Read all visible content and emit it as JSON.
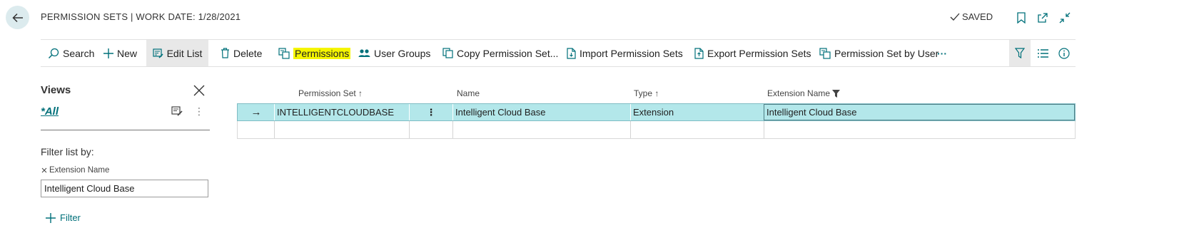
{
  "header": {
    "title": "PERMISSION SETS | WORK DATE: 1/28/2021",
    "saved_label": "SAVED"
  },
  "toolbar": {
    "search": "Search",
    "new": "New",
    "edit_list": "Edit List",
    "delete": "Delete",
    "permissions": "Permissions",
    "user_groups": "User Groups",
    "copy_permission_set": "Copy Permission Set...",
    "import_permission_sets": "Import Permission Sets",
    "export_permission_sets": "Export Permission Sets",
    "permission_set_by_user": "Permission Set by User",
    "more": "···"
  },
  "filter_pane": {
    "views_title": "Views",
    "view_all": "*All",
    "more": "⋮",
    "filter_list_by": "Filter list by:",
    "filter_field": "Extension Name",
    "filter_value": "Intelligent Cloud Base",
    "add_filter": "Filter"
  },
  "grid": {
    "columns": {
      "permission_set": "Permission Set ↑",
      "name": "Name",
      "type": "Type ↑",
      "extension_name": "Extension Name"
    },
    "rows": [
      {
        "indicator": "→",
        "permission_set": "INTELLIGENTCLOUDBASE",
        "actions": "⋮",
        "name": "Intelligent Cloud Base",
        "type": "Extension",
        "extension_name": "Intelligent Cloud Base"
      }
    ]
  },
  "colors": {
    "accent": "#00707a",
    "selected_row": "#b3e7ea",
    "highlight": "#f5f500",
    "back_button_bg": "#dcebee"
  }
}
